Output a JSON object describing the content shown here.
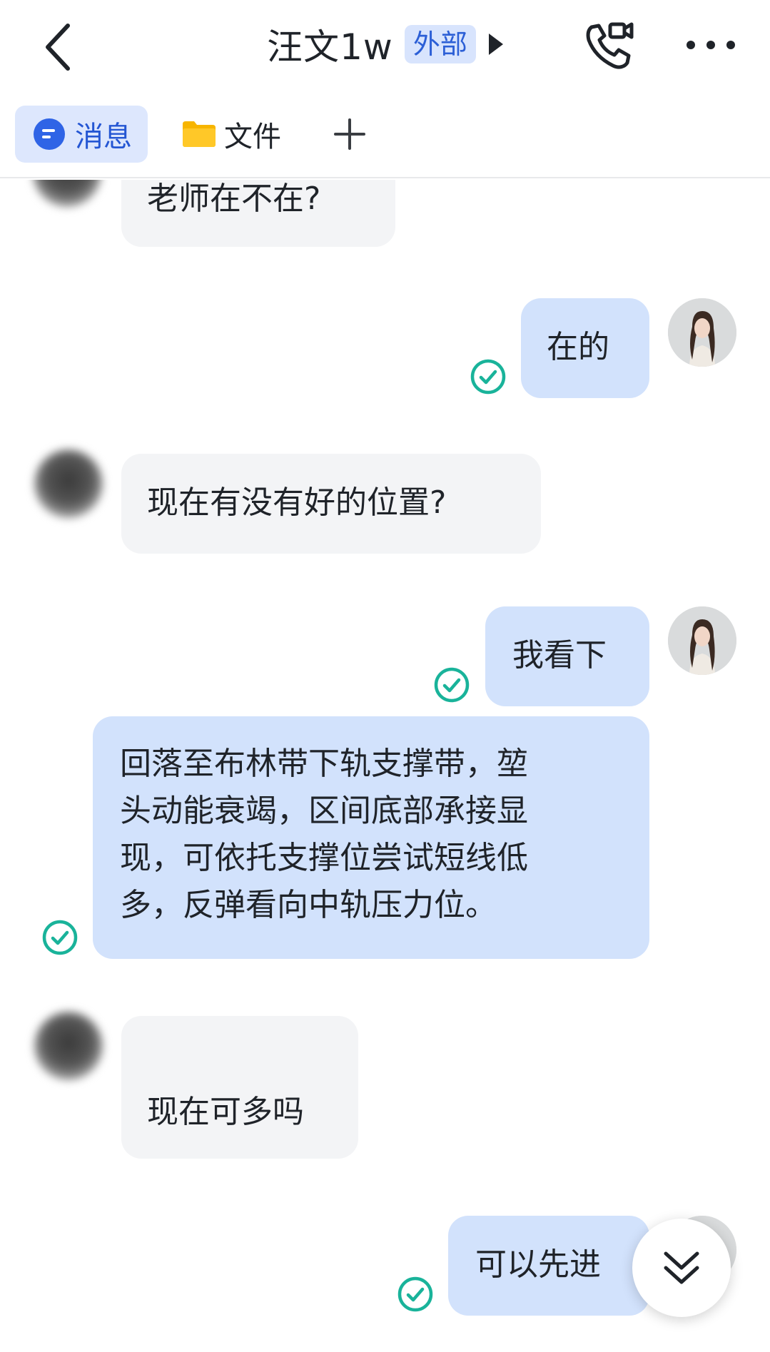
{
  "header": {
    "title": "汪文1w",
    "badge": "外部"
  },
  "tabs": [
    {
      "label": "消息"
    },
    {
      "label": "文件"
    },
    {
      "label": "+"
    }
  ],
  "messages": [
    {
      "side": "in",
      "text": "老师在不在?"
    },
    {
      "side": "out",
      "text": "在的",
      "status": "read"
    },
    {
      "side": "in",
      "text": "现在有没有好的位置?"
    },
    {
      "side": "out",
      "text": "我看下",
      "status": "read"
    },
    {
      "side": "out",
      "lines": [
        "回落至布林带下轨支撑带，堃",
        "头动能衰竭，区间底部承接显",
        "现，可依托支撑位尝试短线低",
        "多，反弹看向中轨压力位。"
      ],
      "status": "read"
    },
    {
      "side": "in",
      "text": "现在可多吗"
    },
    {
      "side": "out",
      "text": "可以先进",
      "status": "read"
    }
  ],
  "colors": {
    "accent": "#2f64e6",
    "outgoing_bubble": "#d2e2fc",
    "incoming_bubble": "#f3f4f6",
    "read_check": "#19b39a",
    "badge_bg": "#d8e4fd"
  },
  "icons": {
    "back": "chevron-left-icon",
    "call": "phone-video-icon",
    "more": "more-horizontal-icon",
    "message_tab": "message-bubble-icon",
    "file_tab": "folder-icon",
    "read": "check-circle-icon",
    "scroll": "double-chevron-down-icon"
  }
}
